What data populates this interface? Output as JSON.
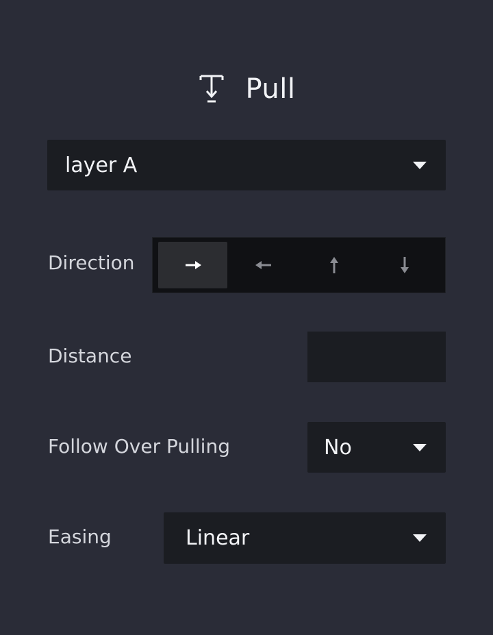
{
  "panel": {
    "title": "Pull",
    "title_icon": "pull-down-icon"
  },
  "layer_select": {
    "value": "layer A"
  },
  "direction": {
    "label": "Direction",
    "options": [
      {
        "icon": "arrow-right-icon",
        "selected": true
      },
      {
        "icon": "arrow-left-icon",
        "selected": false
      },
      {
        "icon": "arrow-up-icon",
        "selected": false
      },
      {
        "icon": "arrow-down-icon",
        "selected": false
      }
    ]
  },
  "distance": {
    "label": "Distance",
    "value": ""
  },
  "follow_over_pulling": {
    "label": "Follow Over Pulling",
    "value": "No"
  },
  "easing": {
    "label": "Easing",
    "value": "Linear"
  },
  "colors": {
    "background": "#2a2c37",
    "field": "#1b1d22",
    "segment_active": "#2c2d31",
    "text": "#f2f3f6"
  }
}
